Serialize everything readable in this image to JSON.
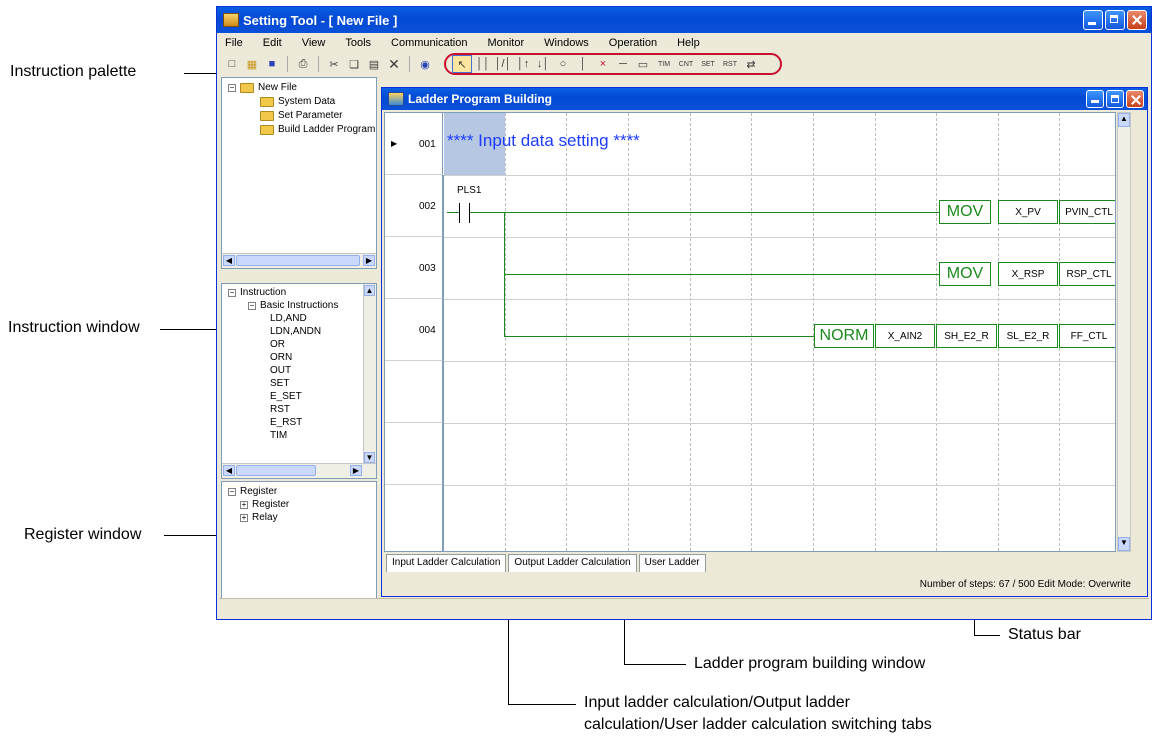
{
  "window": {
    "title": "Setting Tool - [ New File ]",
    "menu": [
      "File",
      "Edit",
      "View",
      "Tools",
      "Communication",
      "Monitor",
      "Windows",
      "Operation",
      "Help"
    ]
  },
  "toolbar": {
    "file_icons": [
      "new-file-icon",
      "open-folder-icon",
      "save-icon",
      "print-icon",
      "cut-icon",
      "copy-icon",
      "paste-icon",
      "delete-icon",
      "globe-icon"
    ],
    "palette_labels": {
      "timer": "TIM",
      "counter": "CNT",
      "set": "SET",
      "reset": "RST"
    }
  },
  "project_tree": {
    "root": "New File",
    "children": [
      "System Data",
      "Set Parameter",
      "Build Ladder Program"
    ]
  },
  "instruction_tree": {
    "root": "Instruction",
    "group": "Basic Instructions",
    "items": [
      "LD,AND",
      "LDN,ANDN",
      "OR",
      "ORN",
      "OUT",
      "SET",
      "E_SET",
      "RST",
      "E_RST",
      "TIM"
    ]
  },
  "register_tree": {
    "root": "Register",
    "children": [
      "Register",
      "Relay"
    ]
  },
  "ladder": {
    "title": "Ladder Program Building",
    "rows": [
      {
        "num": "001",
        "comment": "**** Input data setting ****"
      },
      {
        "num": "002",
        "contact": "PLS1",
        "instr": "MOV",
        "op1": "X_PV",
        "op2": "PVIN_CTL"
      },
      {
        "num": "003",
        "instr": "MOV",
        "op1": "X_RSP",
        "op2": "RSP_CTL"
      },
      {
        "num": "004",
        "instr": "NORM",
        "op1": "X_AIN2",
        "op2": "SH_E2_R",
        "op3": "SL_E2_R",
        "op4": "FF_CTL"
      }
    ],
    "tabs": [
      "Input Ladder Calculation",
      "Output Ladder Calculation",
      "User Ladder"
    ],
    "status": "Number of steps: 67 / 500 Edit Mode: Overwrite"
  },
  "callouts": {
    "instruction_palette": "Instruction palette",
    "instruction_window": "Instruction window",
    "register_window": "Register window",
    "status_bar": "Status bar",
    "ladder_window": "Ladder program building window",
    "tabs_line1": "Input ladder calculation/Output ladder",
    "tabs_line2": "calculation/User ladder calculation switching tabs"
  },
  "colors": {
    "callout_marker": "#c8102e",
    "ladder_green": "#1a8a1a",
    "comment_blue": "#1e3cff",
    "title_blue": "#0349d4"
  }
}
